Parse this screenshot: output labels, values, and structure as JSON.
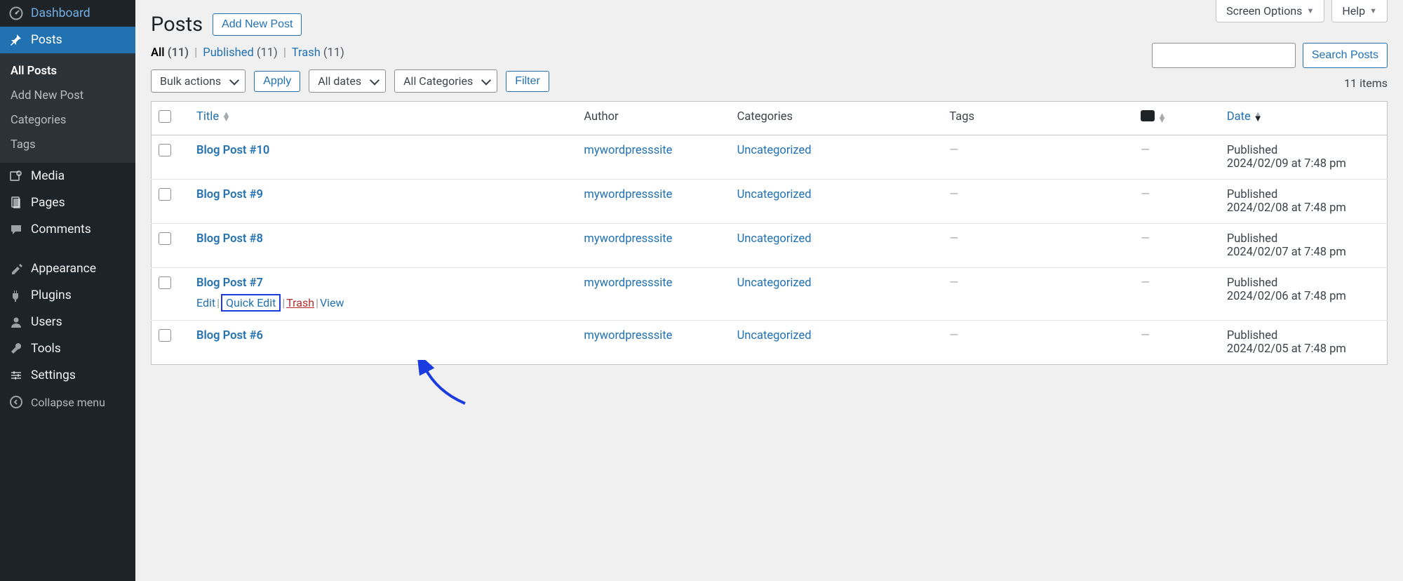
{
  "sidebar": {
    "dashboard": "Dashboard",
    "posts": "Posts",
    "media": "Media",
    "pages": "Pages",
    "comments": "Comments",
    "appearance": "Appearance",
    "plugins": "Plugins",
    "users": "Users",
    "tools": "Tools",
    "settings": "Settings",
    "collapse": "Collapse menu",
    "submenu": {
      "all_posts": "All Posts",
      "add_new": "Add New Post",
      "categories": "Categories",
      "tags": "Tags"
    }
  },
  "topright": {
    "screen_options": "Screen Options",
    "help": "Help"
  },
  "header": {
    "title": "Posts",
    "add_new": "Add New Post"
  },
  "filters": {
    "all_label": "All",
    "all_count": "(11)",
    "published_label": "Published",
    "published_count": "(11)",
    "trash_label": "Trash",
    "trash_count": "(11)"
  },
  "tablenav": {
    "bulk": "Bulk actions",
    "apply": "Apply",
    "all_dates": "All dates",
    "all_categories": "All Categories",
    "filter": "Filter",
    "search_button": "Search Posts",
    "items_count": "11 items"
  },
  "columns": {
    "title": "Title",
    "author": "Author",
    "categories": "Categories",
    "tags": "Tags",
    "date": "Date"
  },
  "row_actions": {
    "edit": "Edit",
    "quick_edit": "Quick Edit",
    "trash": "Trash",
    "view": "View"
  },
  "posts": [
    {
      "title": "Blog Post #10",
      "author": "mywordpresssite",
      "category": "Uncategorized",
      "tags": "—",
      "comments": "—",
      "date_label": "Published",
      "date": "2024/02/09 at 7:48 pm",
      "hovered": false
    },
    {
      "title": "Blog Post #9",
      "author": "mywordpresssite",
      "category": "Uncategorized",
      "tags": "—",
      "comments": "—",
      "date_label": "Published",
      "date": "2024/02/08 at 7:48 pm",
      "hovered": false
    },
    {
      "title": "Blog Post #8",
      "author": "mywordpresssite",
      "category": "Uncategorized",
      "tags": "—",
      "comments": "—",
      "date_label": "Published",
      "date": "2024/02/07 at 7:48 pm",
      "hovered": false
    },
    {
      "title": "Blog Post #7",
      "author": "mywordpresssite",
      "category": "Uncategorized",
      "tags": "—",
      "comments": "—",
      "date_label": "Published",
      "date": "2024/02/06 at 7:48 pm",
      "hovered": true
    },
    {
      "title": "Blog Post #6",
      "author": "mywordpresssite",
      "category": "Uncategorized",
      "tags": "—",
      "comments": "—",
      "date_label": "Published",
      "date": "2024/02/05 at 7:48 pm",
      "hovered": false
    }
  ]
}
